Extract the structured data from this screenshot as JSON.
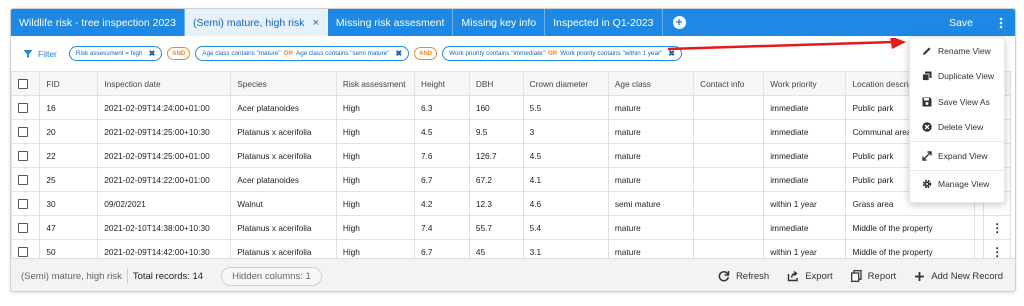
{
  "tabs": [
    {
      "label": "Wildlife risk - tree inspection 2023",
      "active": false
    },
    {
      "label": "(Semi) mature, high risk",
      "active": true
    },
    {
      "label": "Missing risk assesment",
      "active": false
    },
    {
      "label": "Missing key info",
      "active": false
    },
    {
      "label": "Inspected in Q1-2023",
      "active": false
    }
  ],
  "tab_close_glyph": "×",
  "add_tab_glyph": "+",
  "save_label": "Save",
  "filter_label": "Filter",
  "filters": {
    "chip1": {
      "text": "Risk assessment = high"
    },
    "and1": "AND",
    "chip2": {
      "a": "Age class contains \"mature\"",
      "or": "OR",
      "b": "Age class contains \"semi mature\""
    },
    "and2": "AND",
    "chip3": {
      "a": "Work priority contains \"immediate\"",
      "or": "OR",
      "b": "Work priority contains \"within 1 year\""
    }
  },
  "table": {
    "columns": [
      "FID",
      "Inspection date",
      "Species",
      "Risk assessment",
      "Height",
      "DBH",
      "Crown diameter",
      "Age class",
      "Contact info",
      "Work priority",
      "Location description"
    ],
    "rows": [
      [
        "16",
        "2021-02-09T14:24:00+01:00",
        "Acer platanoides",
        "High",
        "6.3",
        "160",
        "5.5",
        "mature",
        "",
        "immediate",
        "Public park"
      ],
      [
        "20",
        "2021-02-09T14:25:00+10:30",
        "Platanus x acerifolia",
        "High",
        "4.5",
        "9.5",
        "3",
        "mature",
        "",
        "immediate",
        "Communal area"
      ],
      [
        "22",
        "2021-02-09T14:25:00+01:00",
        "Platanus x acerifolia",
        "High",
        "7.6",
        "126.7",
        "4.5",
        "mature",
        "",
        "immediate",
        "Public park"
      ],
      [
        "25",
        "2021-02-09T14:22:00+01:00",
        "Acer platanoides",
        "High",
        "6.7",
        "67.2",
        "4.1",
        "mature",
        "",
        "immediate",
        "Public park"
      ],
      [
        "30",
        "09/02/2021",
        "Walnut",
        "High",
        "4.2",
        "12.3",
        "4.6",
        "semi mature",
        "",
        "within 1 year",
        "Grass area"
      ],
      [
        "47",
        "2021-02-10T14:38:00+10:30",
        "Platanus x acerifolia",
        "High",
        "7.4",
        "55.7",
        "5.4",
        "mature",
        "",
        "immediate",
        "Middle of the property"
      ],
      [
        "50",
        "2021-02-09T14:42:00+10:30",
        "Platanus x acerifolia",
        "High",
        "6.7",
        "45",
        "3.1",
        "mature",
        "",
        "within 1 year",
        "Middle of the property"
      ]
    ]
  },
  "footer": {
    "view_name": "(Semi) mature, high risk",
    "total": "Total records: 14",
    "hidden": "Hidden columns: 1",
    "refresh": "Refresh",
    "export": "Export",
    "report": "Report",
    "add": "Add New Record"
  },
  "menu": {
    "rename": "Rename View",
    "duplicate": "Duplicate View",
    "save_as": "Save View As",
    "delete": "Delete View",
    "expand": "Expand View",
    "manage": "Manage View"
  },
  "colors": {
    "accent": "#1e88e5",
    "or": "#ef8a2a",
    "arrow": "#e41b1b"
  }
}
